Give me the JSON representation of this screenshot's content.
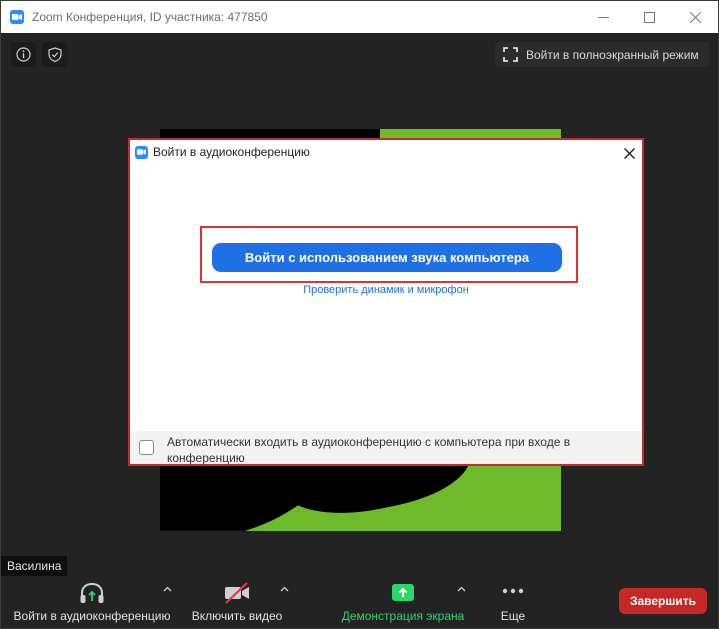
{
  "window": {
    "title": "Zoom Конференция, ID участника: 477850",
    "fullscreen_label": "Войти в полноэкранный режим"
  },
  "dialog": {
    "title": "Войти в аудиоконференцию",
    "join_button_label": "Войти с использованием звука компьютера",
    "test_link_label": "Проверить динамик и микрофон",
    "auto_join_label": "Автоматически входить в аудиоконференцию с компьютера при входе в конференцию",
    "auto_join_checked": false
  },
  "participant": {
    "name": "Василина"
  },
  "toolbar": {
    "audio_label": "Войти в аудиоконференцию",
    "video_label": "Включить видео",
    "share_label": "Демонстрация экрана",
    "more_label": "Еще",
    "end_label": "Завершить"
  },
  "colors": {
    "accent_blue": "#1f6fe5",
    "share_green": "#2bd66b",
    "end_red": "#c62828",
    "highlight_red": "#d33333",
    "video_green": "#6dbb2a"
  },
  "icons": [
    "zoom-logo-icon",
    "info-icon",
    "shield-icon",
    "fullscreen-icon",
    "close-icon",
    "headphones-icon",
    "video-off-icon",
    "share-screen-icon",
    "more-icon",
    "caret-up-icon"
  ]
}
